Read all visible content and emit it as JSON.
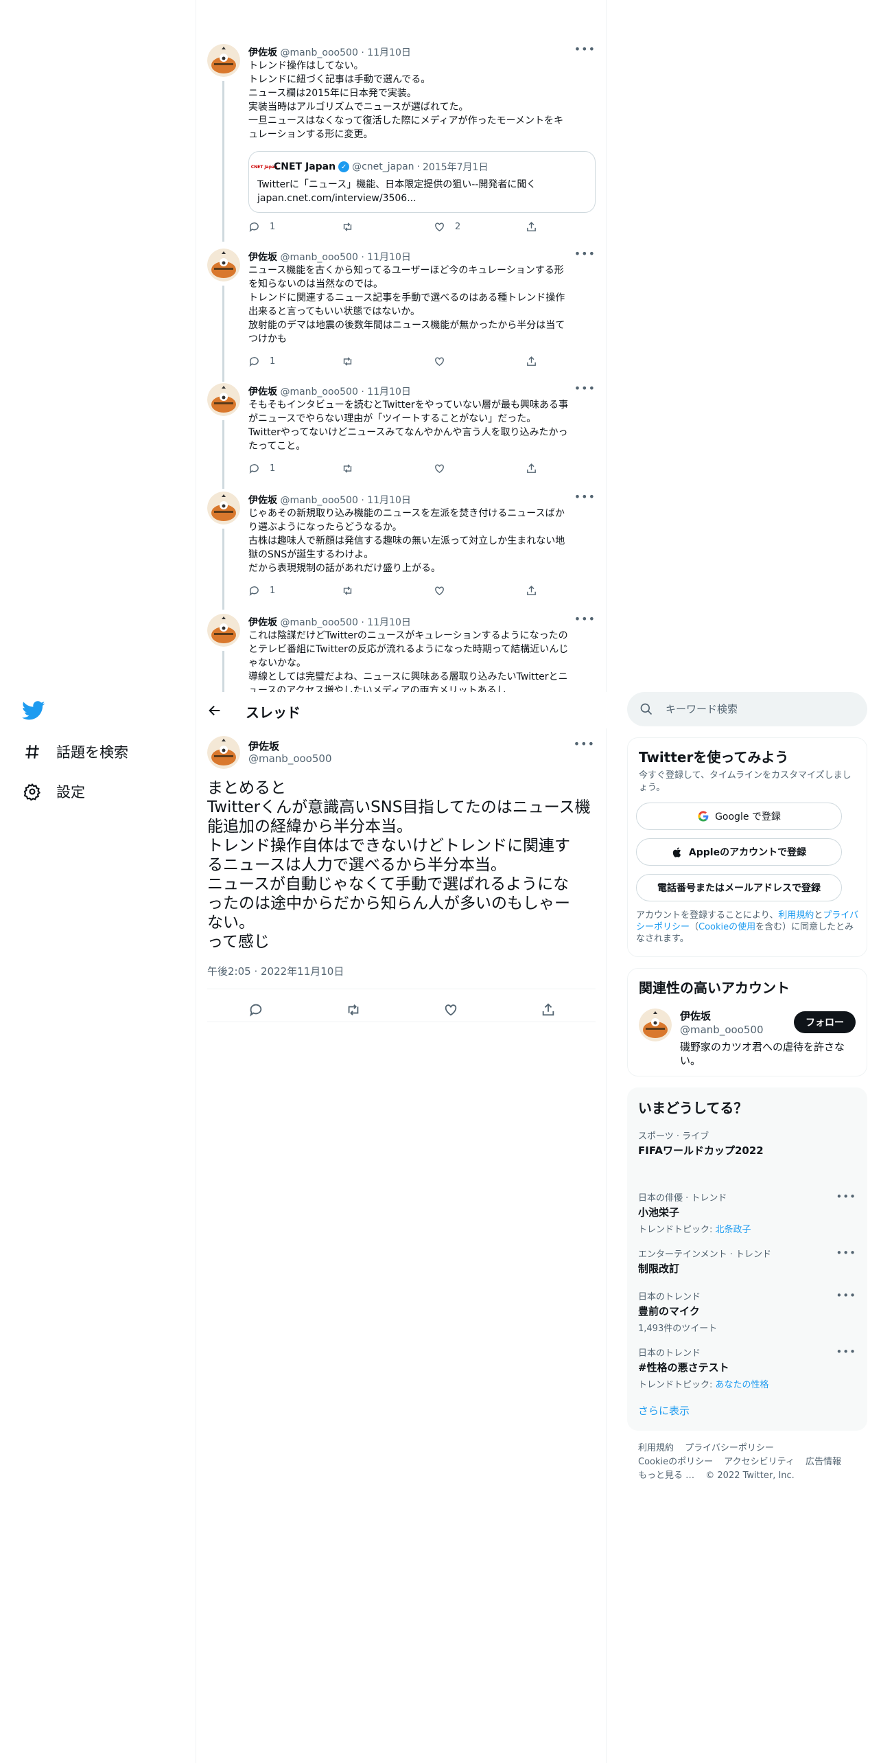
{
  "nav": {
    "items": [
      {
        "label": "話題を検索",
        "icon": "hashtag-icon"
      },
      {
        "label": "設定",
        "icon": "gear-icon"
      }
    ]
  },
  "thread_tweets": [
    {
      "name": "伊佐坂",
      "handle": "@manb_ooo500",
      "date": "11月10日",
      "lines": [
        "トレンド操作はしてない。",
        "トレンドに紐づく記事は手動で選んでる。",
        "ニュース欄は2015年に日本発で実装。",
        "実装当時はアルゴリズムでニュースが選ばれてた。",
        "一旦ニュースはなくなって復活した際にメディアが作ったモーメントをキ",
        "ュレーションする形に変更。"
      ],
      "quote": {
        "logo": "CNET Japan",
        "name": "CNET Japan",
        "handle": "@cnet_japan",
        "date": "2015年7月1日",
        "lines": [
          "Twitterに「ニュース」機能、日本限定提供の狙い--開発者に聞く",
          "japan.cnet.com/interview/3506..."
        ]
      },
      "replies": "1",
      "retweets": "",
      "likes": "2"
    },
    {
      "name": "伊佐坂",
      "handle": "@manb_ooo500",
      "date": "11月10日",
      "lines": [
        "ニュース機能を古くから知ってるユーザーほど今のキュレーションする形",
        "を知らないのは当然なのでは。",
        "トレンドに関連するニュース記事を手動で選べるのはある種トレンド操作",
        "出来ると言ってもいい状態ではないか。",
        "放射能のデマは地震の後数年間はニュース機能が無かったから半分は当て",
        "つけかも"
      ],
      "replies": "1",
      "retweets": "",
      "likes": ""
    },
    {
      "name": "伊佐坂",
      "handle": "@manb_ooo500",
      "date": "11月10日",
      "lines": [
        "そもそもインタビューを読むとTwitterをやっていない層が最も興味ある事",
        "がニュースでやらない理由が「ツイートすることがない」だった。",
        "Twitterやってないけどニュースみてなんやかんや言う人を取り込みたかっ",
        "たってこと。"
      ],
      "replies": "1",
      "retweets": "",
      "likes": ""
    },
    {
      "name": "伊佐坂",
      "handle": "@manb_ooo500",
      "date": "11月10日",
      "lines": [
        "じゃあその新規取り込み機能のニュースを左派を焚き付けるニュースばか",
        "り選ぶようになったらどうなるか。",
        "古株は趣味人で新顔は発信する趣味の無い左派って対立しか生まれない地",
        "獄のSNSが誕生するわけよ。",
        "だから表現規制の話があれだけ盛り上がる。"
      ],
      "replies": "1",
      "retweets": "",
      "likes": ""
    },
    {
      "name": "伊佐坂",
      "handle": "@manb_ooo500",
      "date": "11月10日",
      "lines": [
        "これは陰謀だけどTwitterのニュースがキュレーションするようになったの",
        "とテレビ番組にTwitterの反応が流れるようになった時期って結構近いんじ",
        "ゃないかな。",
        "導線としては完璧だよね、ニュースに興味ある層取り込みたいTwitterとニ",
        "ュースのアクセス増やしたいメディアの両方メリットあるし"
      ]
    }
  ],
  "header": {
    "title": "スレッド"
  },
  "main_tweet": {
    "name": "伊佐坂",
    "handle": "@manb_ooo500",
    "lines": [
      "まとめると",
      "Twitterくんが意識高いSNS目指してたのはニュース機",
      "能追加の経緯から半分本当。",
      "トレンド操作自体はできないけどトレンドに関連す",
      "るニュースは人力で選べるから半分本当。",
      "ニュースが自動じゃなくて手動で選ばれるようにな",
      "ったのは途中からだから知らん人が多いのもしゃー",
      "ない。",
      "って感じ"
    ],
    "timestamp": "午後2:05 · 2022年11月10日"
  },
  "search": {
    "placeholder": "キーワード検索"
  },
  "signup": {
    "title": "Twitterを使ってみよう",
    "subtitle": "今すぐ登録して、タイムラインをカスタマイズしましょう。",
    "google": "Google で登録",
    "apple": "Appleのアカウントで登録",
    "phone": "電話番号またはメールアドレスで登録",
    "legal_prefix": "アカウントを登録することにより、",
    "terms": "利用規約",
    "and": "と",
    "privacy": "プライバシーポリシー",
    "cookie_open": "（",
    "cookie": "Cookieの使用",
    "legal_suffix": "を含む）に同意したとみなされます。"
  },
  "relevant": {
    "title": "関連性の高いアカウント",
    "name": "伊佐坂",
    "handle": "@manb_ooo500",
    "bio": "磯野家のカツオ君への虐待を許さない。",
    "follow": "フォロー"
  },
  "trends": {
    "title": "いまどうしてる？",
    "items": [
      {
        "category": "スポーツ · ライブ",
        "name": "FIFAワールドカップ2022",
        "sub_prefix": "",
        "sub_link": "",
        "more": false
      },
      {
        "category": "日本の俳優 · トレンド",
        "name": "小池栄子",
        "sub_prefix": "トレンドトピック: ",
        "sub_link": "北条政子",
        "more": true
      },
      {
        "category": "エンターテインメント · トレンド",
        "name": "制限改訂",
        "sub_prefix": "",
        "sub_link": "",
        "more": true
      },
      {
        "category": "日本のトレンド",
        "name": "豊前のマイク",
        "sub_prefix": "1,493件のツイート",
        "sub_link": "",
        "more": true
      },
      {
        "category": "日本のトレンド",
        "name": "#性格の悪さテスト",
        "sub_prefix": "トレンドトピック: ",
        "sub_link": "あなたの性格",
        "more": true
      }
    ],
    "show_more": "さらに表示"
  },
  "footer": {
    "links": [
      "利用規約",
      "プライバシーポリシー",
      "Cookieのポリシー",
      "アクセシビリティ",
      "広告情報",
      "もっと見る …"
    ],
    "copyright": "© 2022 Twitter, Inc."
  },
  "colors": {
    "accent": "#1d9bf0",
    "text": "#0f1419",
    "muted": "#536471",
    "border": "#eff3f4"
  }
}
